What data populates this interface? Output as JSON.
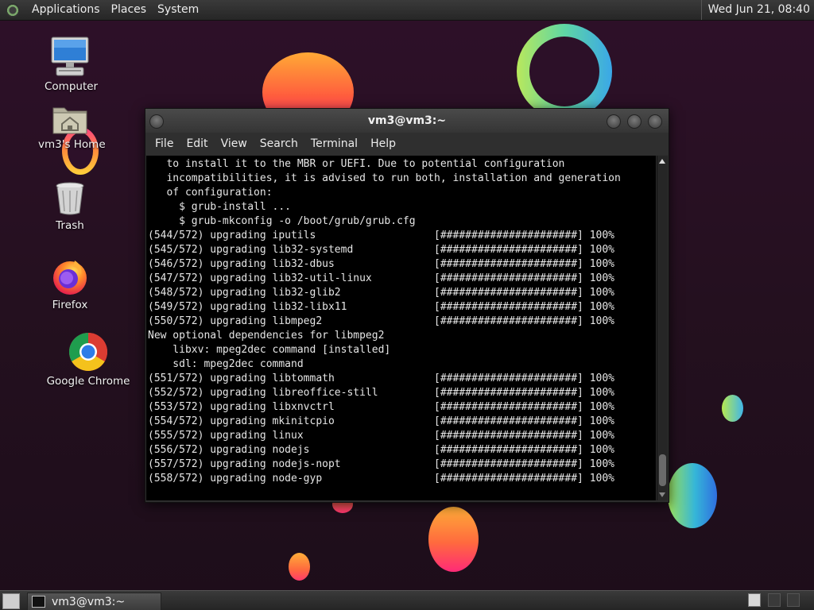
{
  "top_panel": {
    "menus": [
      "Applications",
      "Places",
      "System"
    ],
    "clock": "Wed Jun 21, 08:40"
  },
  "desktop_icons": [
    {
      "label": "Computer",
      "icon": "computer-icon"
    },
    {
      "label": "vm3's Home",
      "icon": "home-folder-icon"
    },
    {
      "label": "Trash",
      "icon": "trash-icon"
    },
    {
      "label": "Firefox",
      "icon": "firefox-icon"
    },
    {
      "label": "Google Chrome",
      "icon": "chrome-icon"
    }
  ],
  "window": {
    "title": "vm3@vm3:~",
    "menus": [
      "File",
      "Edit",
      "View",
      "Search",
      "Terminal",
      "Help"
    ],
    "lines": [
      "   to install it to the MBR or UEFI. Due to potential configuration",
      "   incompatibilities, it is advised to run both, installation and generation",
      "   of configuration:",
      "     $ grub-install ...",
      "     $ grub-mkconfig -o /boot/grub/grub.cfg",
      "(544/572) upgrading iputils                   [######################] 100%",
      "(545/572) upgrading lib32-systemd             [######################] 100%",
      "(546/572) upgrading lib32-dbus                [######################] 100%",
      "(547/572) upgrading lib32-util-linux          [######################] 100%",
      "(548/572) upgrading lib32-glib2               [######################] 100%",
      "(549/572) upgrading lib32-libx11              [######################] 100%",
      "(550/572) upgrading libmpeg2                  [######################] 100%",
      "New optional dependencies for libmpeg2",
      "    libxv: mpeg2dec command [installed]",
      "    sdl: mpeg2dec command",
      "(551/572) upgrading libtommath                [######################] 100%",
      "(552/572) upgrading libreoffice-still         [######################] 100%",
      "(553/572) upgrading libxnvctrl                [######################] 100%",
      "(554/572) upgrading mkinitcpio                [######################] 100%",
      "(555/572) upgrading linux                     [######################] 100%",
      "(556/572) upgrading nodejs                    [######################] 100%",
      "(557/572) upgrading nodejs-nopt               [######################] 100%",
      "(558/572) upgrading node-gyp                  [######################] 100%"
    ]
  },
  "taskbar": {
    "task_label": "vm3@vm3:~"
  },
  "colors": {
    "desktop_bg": "#2a1126",
    "panel_bg": "#2e2e2e",
    "terminal_bg": "#000000",
    "terminal_fg": "#e6e6e6"
  }
}
